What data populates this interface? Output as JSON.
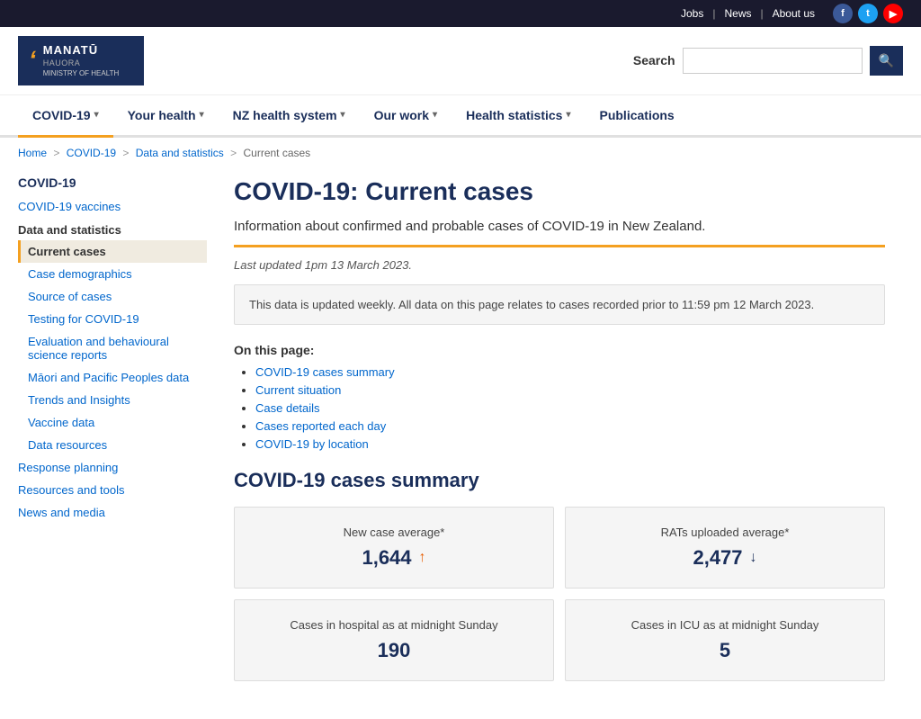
{
  "topbar": {
    "jobs_label": "Jobs",
    "news_label": "News",
    "about_label": "About us"
  },
  "header": {
    "logo_symbol": "ʻ",
    "logo_main": "MANATŪ",
    "logo_sub": "HAUORA",
    "logo_ministry": "MINISTRY OF HEALTH",
    "search_label": "Search",
    "search_placeholder": ""
  },
  "nav": {
    "items": [
      {
        "label": "COVID-19",
        "active": true,
        "has_arrow": true
      },
      {
        "label": "Your health",
        "active": false,
        "has_arrow": true
      },
      {
        "label": "NZ health system",
        "active": false,
        "has_arrow": true
      },
      {
        "label": "Our work",
        "active": false,
        "has_arrow": true
      },
      {
        "label": "Health statistics",
        "active": false,
        "has_arrow": true
      },
      {
        "label": "Publications",
        "active": false,
        "has_arrow": false
      }
    ]
  },
  "breadcrumb": {
    "items": [
      "Home",
      "COVID-19",
      "Data and statistics",
      "Current cases"
    ]
  },
  "sidebar": {
    "section_title": "COVID-19",
    "top_items": [
      {
        "label": "COVID-19 vaccines"
      }
    ],
    "groups": [
      {
        "title": "Data and statistics",
        "items": [
          {
            "label": "Current cases",
            "active": true
          },
          {
            "label": "Case demographics",
            "active": false
          },
          {
            "label": "Source of cases",
            "active": false
          },
          {
            "label": "Testing for COVID-19",
            "active": false
          },
          {
            "label": "Evaluation and behavioural science reports",
            "active": false
          },
          {
            "label": "Māori and Pacific Peoples data",
            "active": false
          },
          {
            "label": "Trends and Insights",
            "active": false
          },
          {
            "label": "Vaccine data",
            "active": false
          },
          {
            "label": "Data resources",
            "active": false
          }
        ]
      }
    ],
    "bottom_items": [
      {
        "label": "Response planning"
      },
      {
        "label": "Resources and tools"
      },
      {
        "label": "News and media"
      }
    ]
  },
  "content": {
    "page_title": "COVID-19: Current cases",
    "subtitle": "Information about confirmed and probable cases of COVID-19 in New Zealand.",
    "last_updated": "Last updated 1pm 13 March 2023.",
    "info_box": "This data is updated weekly. All data on this page relates to cases recorded prior to 11:59 pm 12 March 2023.",
    "on_page_label": "On this page:",
    "on_page_links": [
      "COVID-19 cases summary",
      "Current situation",
      "Case details",
      "Cases reported each day",
      "COVID-19 by location"
    ],
    "summary_title": "COVID-19 cases summary",
    "stats": [
      {
        "label": "New case average*",
        "value": "1,644",
        "arrow": "up"
      },
      {
        "label": "RATs uploaded average*",
        "value": "2,477",
        "arrow": "down"
      },
      {
        "label": "Cases in hospital as at midnight Sunday",
        "value": "190",
        "arrow": "none"
      },
      {
        "label": "Cases in ICU as at midnight Sunday",
        "value": "5",
        "arrow": "none"
      }
    ]
  }
}
